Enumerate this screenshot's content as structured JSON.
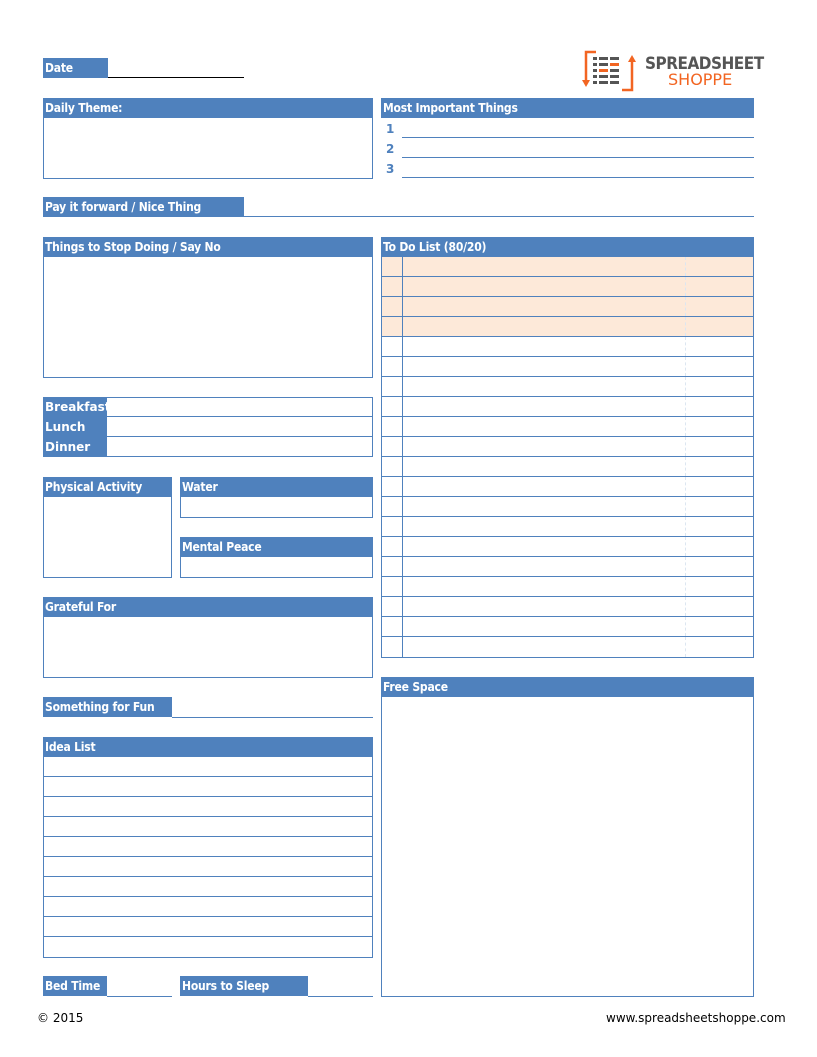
{
  "brand": {
    "name_line1": "SPREADSHEET",
    "name_line2": "SHOPPE",
    "colors": {
      "header_blue": "#4f81bd",
      "priority_peach": "#fde9d9",
      "logo_orange": "#f26522",
      "logo_gray": "#555555"
    }
  },
  "date": {
    "label": "Date",
    "value": ""
  },
  "daily_theme": {
    "label": "Daily Theme:",
    "value": ""
  },
  "most_important": {
    "label": "Most Important Things",
    "items": [
      {
        "num": "1",
        "value": ""
      },
      {
        "num": "2",
        "value": ""
      },
      {
        "num": "3",
        "value": ""
      }
    ]
  },
  "pay_it_forward": {
    "label": "Pay it forward / Nice Thing",
    "value": ""
  },
  "stop_doing": {
    "label": "Things to Stop Doing / Say No",
    "value": ""
  },
  "todo": {
    "label": "To Do List (80/20)",
    "priority_rows": 4,
    "rows": [
      {
        "task": ""
      },
      {
        "task": ""
      },
      {
        "task": ""
      },
      {
        "task": ""
      },
      {
        "task": ""
      },
      {
        "task": ""
      },
      {
        "task": ""
      },
      {
        "task": ""
      },
      {
        "task": ""
      },
      {
        "task": ""
      },
      {
        "task": ""
      },
      {
        "task": ""
      },
      {
        "task": ""
      },
      {
        "task": ""
      },
      {
        "task": ""
      },
      {
        "task": ""
      },
      {
        "task": ""
      },
      {
        "task": ""
      },
      {
        "task": ""
      },
      {
        "task": ""
      }
    ]
  },
  "meals": [
    {
      "label": "Breakfast",
      "value": ""
    },
    {
      "label": "Lunch",
      "value": ""
    },
    {
      "label": "Dinner",
      "value": ""
    }
  ],
  "physical_activity": {
    "label": "Physical Activity",
    "value": ""
  },
  "water": {
    "label": "Water",
    "value": ""
  },
  "mental_peace": {
    "label": "Mental Peace",
    "value": ""
  },
  "grateful_for": {
    "label": "Grateful For",
    "value": ""
  },
  "something_for_fun": {
    "label": "Something for Fun",
    "value": ""
  },
  "free_space": {
    "label": "Free Space",
    "value": ""
  },
  "idea_list": {
    "label": "Idea List",
    "rows": [
      "",
      "",
      "",
      "",
      "",
      "",
      "",
      "",
      "",
      ""
    ]
  },
  "bed_time": {
    "label": "Bed Time",
    "value": ""
  },
  "hours_to_sleep": {
    "label": "Hours to Sleep",
    "value": ""
  },
  "footer": {
    "copyright": "© 2015",
    "website": "www.spreadsheetshoppe.com"
  }
}
